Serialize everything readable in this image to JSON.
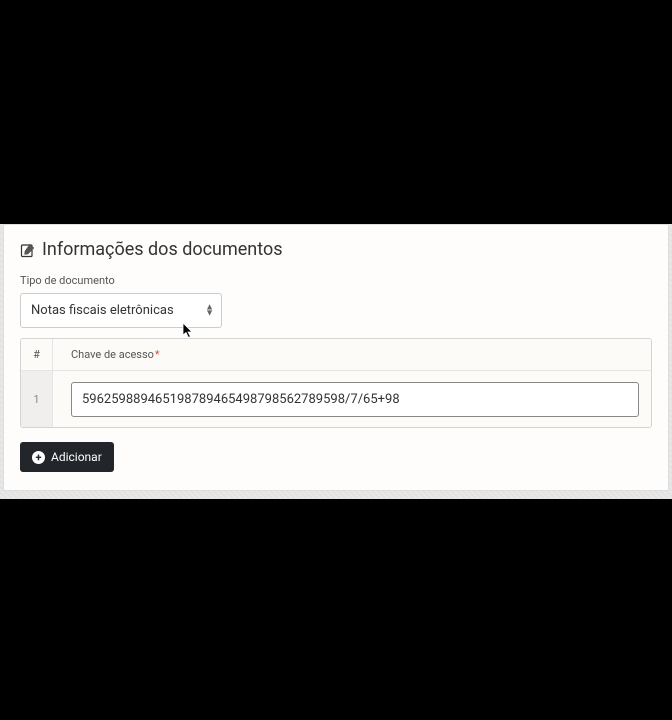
{
  "section": {
    "title": "Informações dos documentos"
  },
  "docType": {
    "label": "Tipo de documento",
    "selected": "Notas fiscais eletrônicas"
  },
  "table": {
    "hashHeader": "#",
    "columnLabel": "Chave de acesso",
    "rows": [
      {
        "index": "1",
        "value": "596259889465198789465498798562789598/7/65+98"
      }
    ]
  },
  "addButton": {
    "label": "Adicionar"
  }
}
